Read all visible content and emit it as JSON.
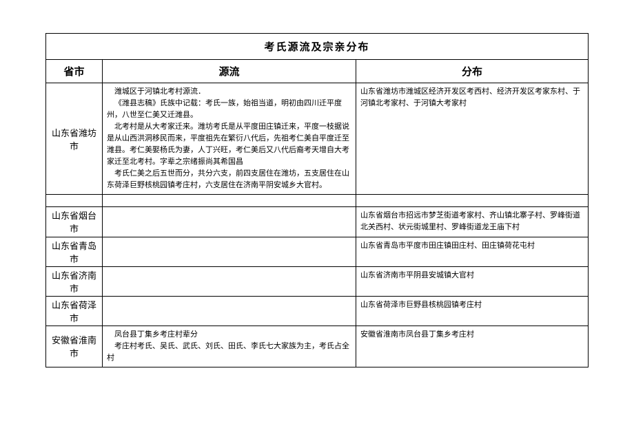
{
  "title": "考氏源流及宗亲分布",
  "headers": {
    "province": "省市",
    "source": "源流",
    "distribution": "分布"
  },
  "rows": [
    {
      "province": "山东省潍坊市",
      "source_paras": [
        "潍城区于河镇北考村源流．",
        "《潍县志稿》氏族中记载：考氏一族，始祖当道，明初由四川迁平度州，八世至仁美又迁潍县。",
        "北考村是从大考家迁来。潍坊考氏是从平度田庄镇迁来，平度一枝据说是从山西洪洞移民而来，平度祖先在繁衍八代后，先祖考仁美自平度迁至潍县。考仁美娶杨氏为妻，人丁兴旺，考仁美后又八代后裔考天增自大考家迁至北考村。字辈之宗绪振尚其希国昌",
        "考氏仁美之后五世而分，共分六支，前四支居住在潍坊，五支居住在山东荷泽巨野核桃园镇考庄村，六支居住在济南平阴安城乡大官村。"
      ],
      "distribution": "山东省潍坊市潍城区经济开发区考西村、经济开发区考家东村、于河镇北考家村、于河镇大考家村"
    },
    {
      "province": "",
      "source_paras": [],
      "distribution": "",
      "blank": true
    },
    {
      "province": "山东省烟台市",
      "source_paras": [],
      "distribution": "山东省烟台市招远市梦芝街道考家村、齐山镇北寨子村、罗峰街道北关西村、状元街城里村、罗峰街道龙王庙下村"
    },
    {
      "province": "山东省青岛市",
      "source_paras": [],
      "distribution": "山东省青岛市平度市田庄镇田庄村、田庄镇荷花屯村"
    },
    {
      "province": "山东省济南市",
      "source_paras": [],
      "distribution": "山东省济南市平阴县安城镇大官村"
    },
    {
      "province": "山东省荷泽市",
      "source_paras": [],
      "distribution": "山东省荷泽市巨野县核桃园镇考庄村"
    },
    {
      "province": "安徽省淮南市",
      "source_paras": [
        "凤台县丁集乡考庄村辈分",
        "考庄村考氏、吴氏、武氏、刘氏、田氏、李氏七大家族为主，考氏占全村"
      ],
      "distribution": "安徽省淮南市凤台县丁集乡考庄村"
    }
  ]
}
